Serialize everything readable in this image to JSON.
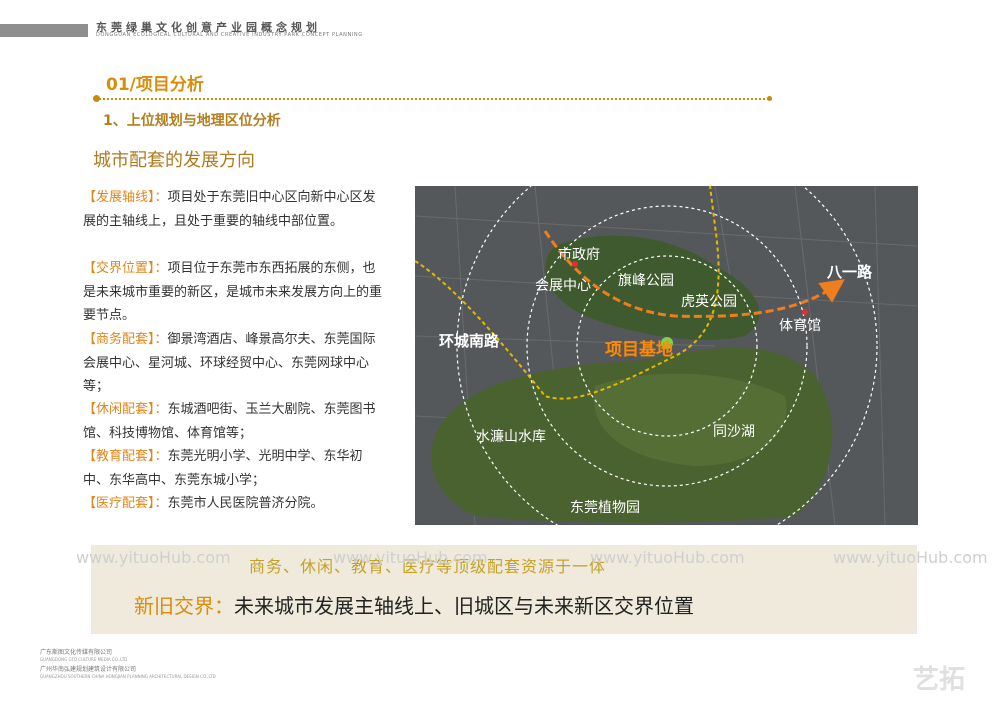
{
  "header": {
    "title": "东莞绿巢文化创意产业园概念规划",
    "subtitle": "DONGGUAN ECOLOGICAL CULTURAL AND CREATIVE INDUSTRY PARK CONCEPT PLANNING"
  },
  "section": {
    "title": "01/项目分析",
    "subtitle": "1、上位规划与地理区位分析",
    "heading": "城市配套的发展方向"
  },
  "paragraphs": [
    {
      "tag": "【发展轴线】",
      "sep": "：",
      "text": "项目处于东莞旧中心区向新中心区发展的主轴线上，且处于重要的轴线中部位置。"
    },
    {
      "tag": "【交界位置】",
      "sep": "：",
      "text": "项目位于东莞市东西拓展的东侧，也是未来城市重要的新区，是城市未来发展方向上的重要节点。"
    },
    {
      "tag": "【商务配套】",
      "sep": "：",
      "text": "御景湾酒店、峰景高尔夫、东莞国际会展中心、星河城、环球经贸中心、东莞网球中心等；"
    },
    {
      "tag": "【休闲配套】",
      "sep": "：",
      "text": "东城酒吧街、玉兰大剧院、东莞图书馆、科技博物馆、体育馆等；"
    },
    {
      "tag": "【教育配套】",
      "sep": "：",
      "text": "东莞光明小学、光明中学、东华初中、东华高中、东莞东城小学；"
    },
    {
      "tag": "【医疗配套】",
      "sep": "：",
      "text": "东莞市人民医院普济分院。"
    }
  ],
  "map": {
    "labels": {
      "city_hall": "市政府",
      "expo": "会展中心",
      "qifeng": "旗峰公园",
      "huying": "虎英公园",
      "bayi": "八一路",
      "stadium": "体育馆",
      "huancheng": "环城南路",
      "site": "项目基地",
      "shuilian": "水濂山水库",
      "tongsha": "同沙湖",
      "botanic": "东莞植物园"
    },
    "colors": {
      "axis": "#f07d1e",
      "road": "#e6b800",
      "site": "#ff8a00",
      "white": "#ffffff"
    }
  },
  "banner": {
    "line1": "商务、休闲、教育、医疗等顶级配套资源于一体",
    "line2_label": "新旧交界：",
    "line2_text": "未来城市发展主轴线上、旧城区与未来新区交界位置"
  },
  "watermarks": [
    "www.yituoHub.com",
    "www.yituoHub.com",
    "www.yituoHub.com",
    "www.yituoHub.com"
  ],
  "footer": {
    "line1": "广东斯图文化传媒有限公司",
    "line1_en": "GUANGDONG GTO CULTURE MEDIA CO.,LTD",
    "line2": "广州华南弘建规划建筑设计有限公司",
    "line2_en": "GUANGZHOU SOUTHERN CHINA HONGJIAN PLANNING ARCHITECTURAL DESIGN CO.,LTD",
    "logo_text": "艺拓"
  }
}
